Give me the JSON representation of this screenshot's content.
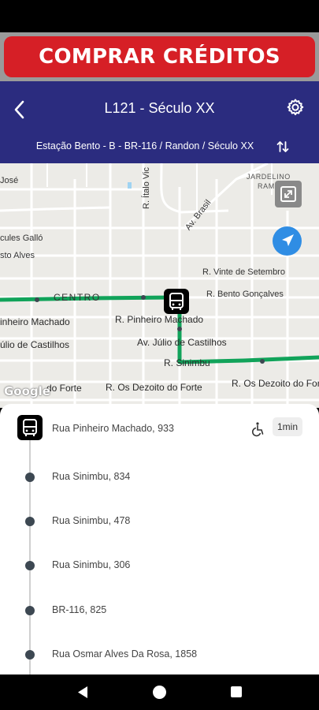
{
  "banner": {
    "buy_label": "COMPRAR CRÉDITOS"
  },
  "header": {
    "title": "L121 - Século XX",
    "direction": "Estação Bento - B - BR-116 / Randon / Século XX"
  },
  "map": {
    "streets": {
      "jose": "José",
      "italo": "R. Ítalo Vic",
      "brasil": "Av. Brasil",
      "jardelino": "JARDELINO",
      "ramos": "RAM",
      "gallo": "cules Galló",
      "alves": "sto Alves",
      "vinte": "R. Vinte de Setembro",
      "bento": "R. Bento Gonçalves",
      "centro": "CENTRO",
      "pinheiro_left": "inheiro Machado",
      "pinheiro": "R. Pinheiro Machado",
      "castilhos_left": "úlio de Castilhos",
      "castilhos": "Av. Júlio de Castilhos",
      "sinimbu": "R. Sinimbu",
      "forte_left": "do Forte",
      "forte_mid": "R. Os Dezoito do Forte",
      "forte_right": "R. Os Dezoito do Fort"
    },
    "google": "Google",
    "route_color": "#11a35a"
  },
  "stops": [
    {
      "name": "Rua Pinheiro Machado, 933",
      "eta": "1min",
      "accessible": true
    },
    {
      "name": "Rua Sinimbu, 834"
    },
    {
      "name": "Rua Sinimbu, 478"
    },
    {
      "name": "Rua Sinimbu, 306"
    },
    {
      "name": "BR-116, 825"
    },
    {
      "name": "Rua Osmar Alves Da Rosa, 1858"
    }
  ],
  "colors": {
    "accent_red": "#d61f26",
    "header_blue": "#2b2c7f",
    "locate_blue": "#2f8de4"
  }
}
